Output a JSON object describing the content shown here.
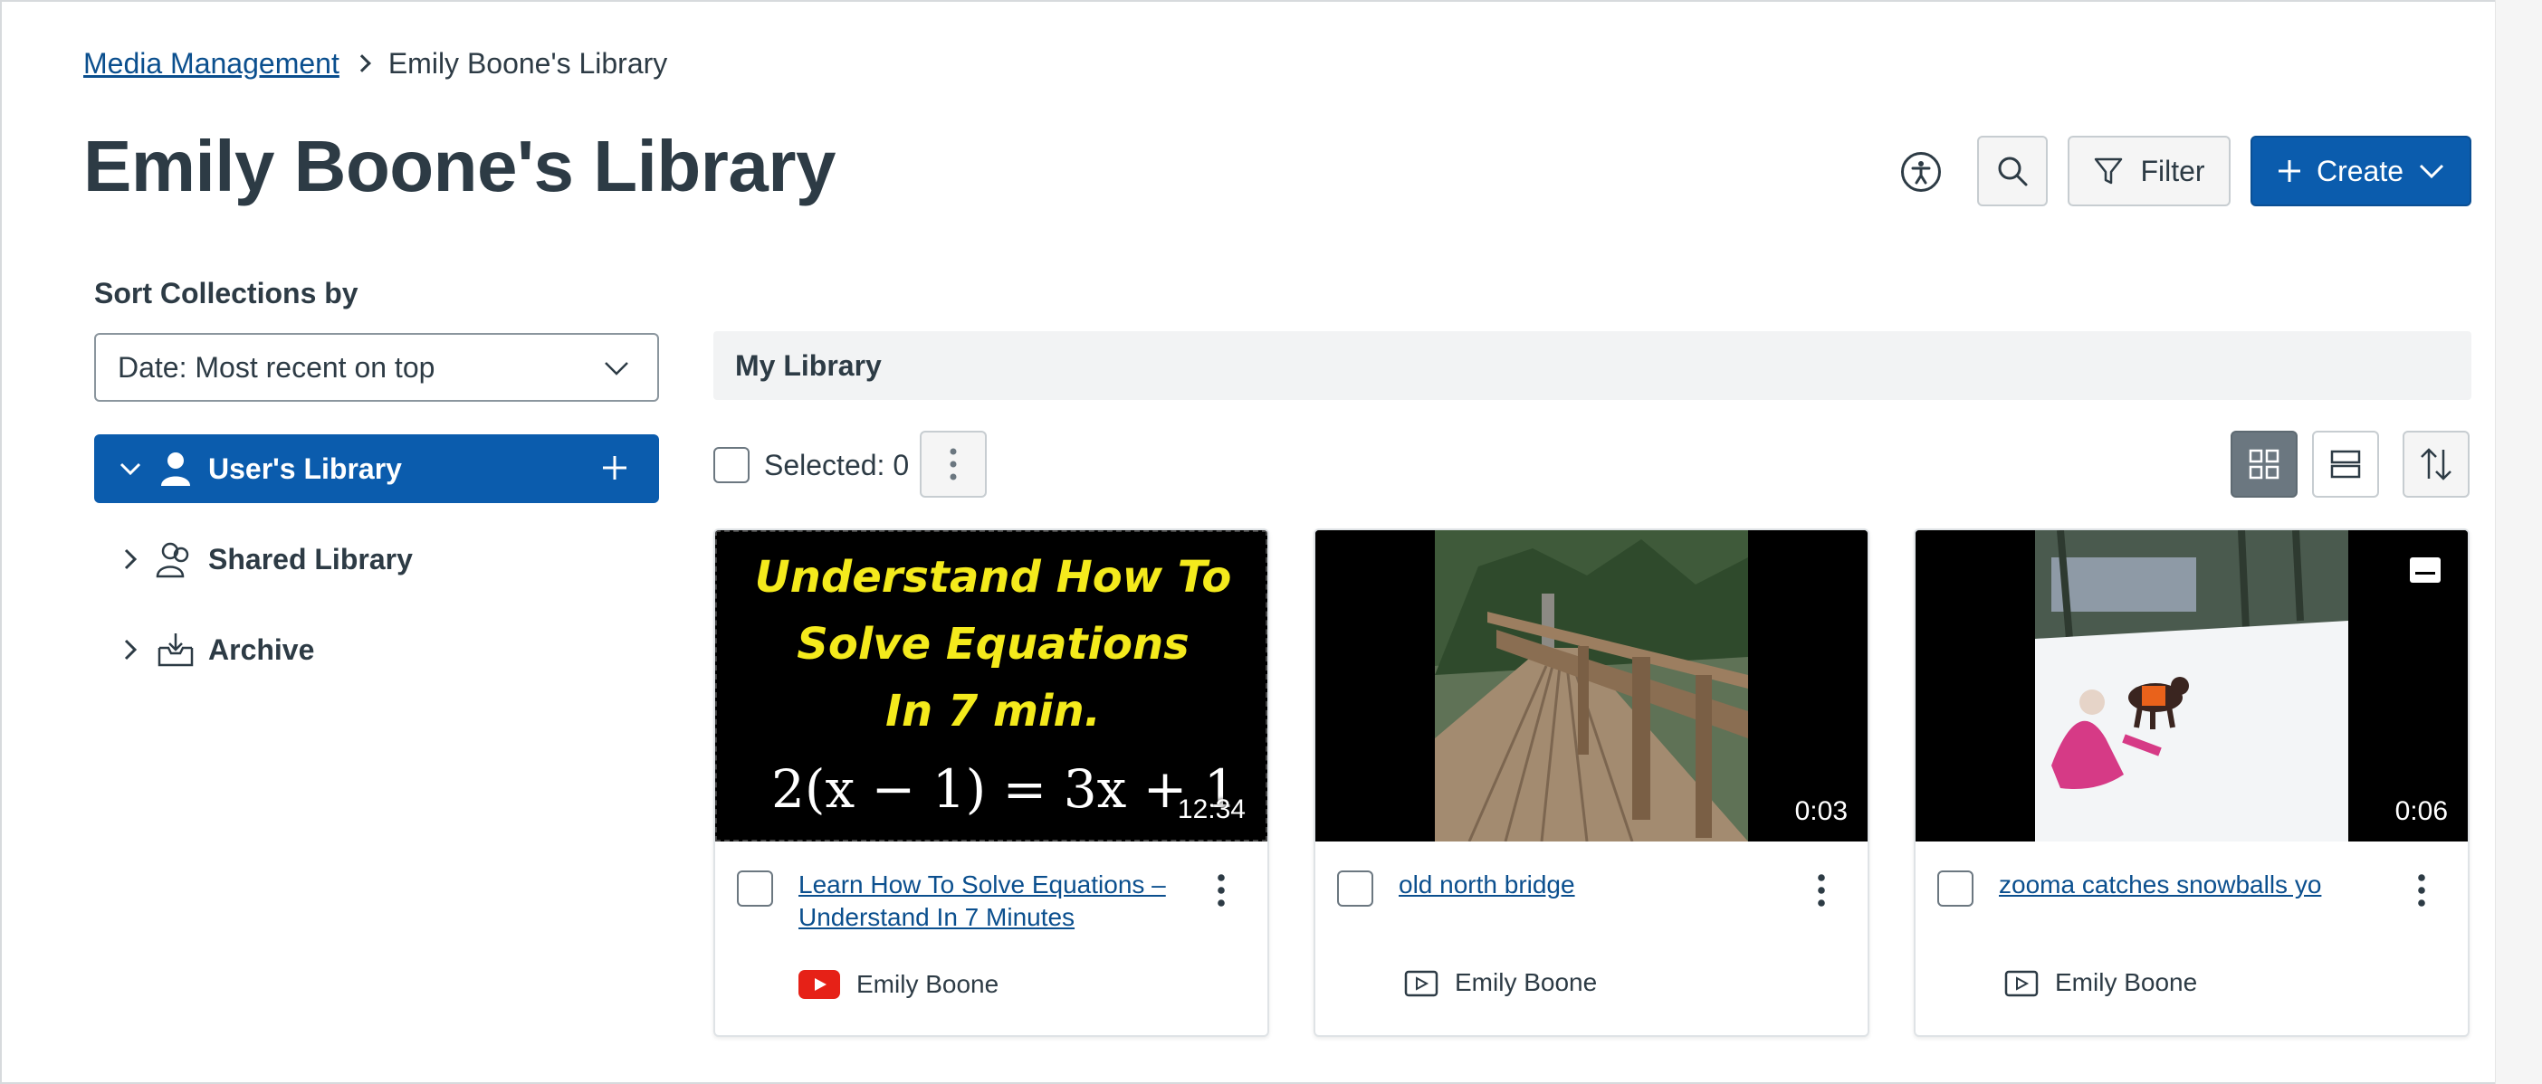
{
  "breadcrumb": {
    "parent": "Media Management",
    "current": "Emily Boone's Library"
  },
  "page": {
    "title": "Emily Boone's Library"
  },
  "header_actions": {
    "filter_label": "Filter",
    "create_label": "Create"
  },
  "sidebar": {
    "sort_label": "Sort Collections by",
    "sort_value": "Date: Most recent on top",
    "tree": [
      {
        "label": "User's Library",
        "icon": "user-library-icon",
        "expanded": true,
        "active": true
      },
      {
        "label": "Shared Library",
        "icon": "shared-library-icon",
        "expanded": false,
        "active": false
      },
      {
        "label": "Archive",
        "icon": "archive-icon",
        "expanded": false,
        "active": false
      }
    ]
  },
  "main": {
    "section_title": "My Library",
    "selected_label": "Selected: 0"
  },
  "cards": [
    {
      "title": "Learn How To Solve Equations – Understand In 7 Minutes",
      "duration": "12:34",
      "owner": "Emily Boone",
      "source_icon": "youtube-icon",
      "thumb_lines": [
        "Understand How To",
        "Solve Equations",
        "In 7 min.",
        "2(x − 1) = 3x + 1"
      ]
    },
    {
      "title": "old north bridge",
      "duration": "0:03",
      "owner": "Emily Boone",
      "source_icon": "video-icon"
    },
    {
      "title": "zooma catches snowballs yo",
      "duration": "0:06",
      "owner": "Emily Boone",
      "source_icon": "video-icon",
      "has_captions": true
    }
  ],
  "colors": {
    "primary": "#0b5cad",
    "link": "#0b4f8e",
    "text": "#2d3b45",
    "youtube_red": "#e62117",
    "thumb_yellow": "#f4ea1c"
  }
}
